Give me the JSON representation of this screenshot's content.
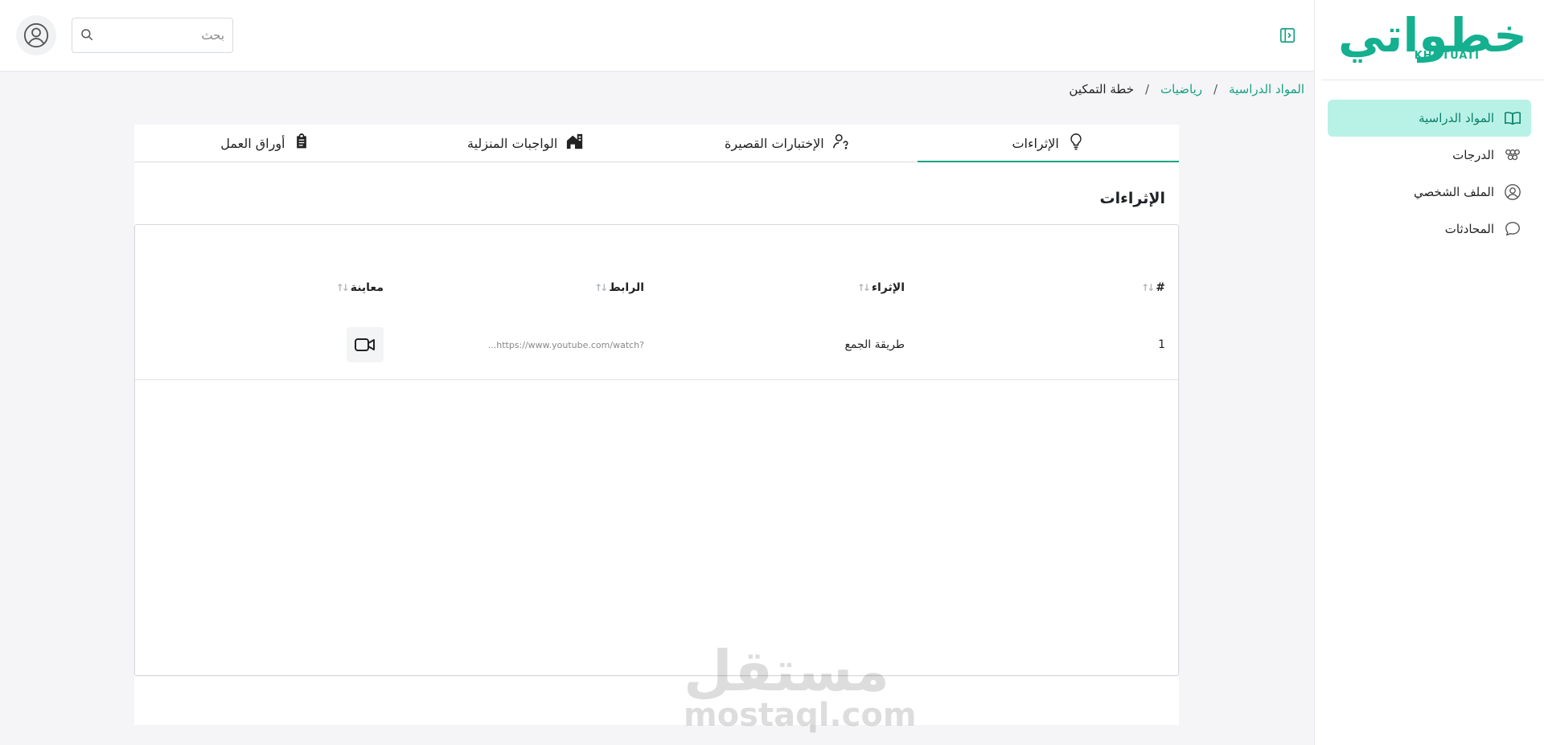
{
  "brand": {
    "logo_ar": "خطواتي",
    "logo_en": "KHUTUATI",
    "color": "#14b08f"
  },
  "sidebar": {
    "items": [
      {
        "label": "المواد الدراسية",
        "icon": "book-icon",
        "active": true
      },
      {
        "label": "الدرجات",
        "icon": "grades-icon",
        "active": false
      },
      {
        "label": "الملف الشخصي",
        "icon": "user-circle-icon",
        "active": false
      },
      {
        "label": "المحادثات",
        "icon": "chat-icon",
        "active": false
      }
    ]
  },
  "header": {
    "search_placeholder": "بحث",
    "search_icon": "search-icon",
    "avatar_icon": "user-avatar-icon",
    "collapse_icon": "sidebar-toggle-icon"
  },
  "breadcrumb": {
    "items": [
      "المواد الدراسية",
      "رياضيات",
      "خطة التمكين"
    ],
    "separator": "/"
  },
  "tabs": [
    {
      "label": "الإثراءات",
      "icon": "lightbulb-icon",
      "active": true
    },
    {
      "label": "الإختبارات القصيرة",
      "icon": "user-question-icon",
      "active": false
    },
    {
      "label": "الواجبات المنزلية",
      "icon": "house-icon",
      "active": false
    },
    {
      "label": "أوراق العمل",
      "icon": "clipboard-icon",
      "active": false
    }
  ],
  "section": {
    "title": "الإثراءات"
  },
  "table": {
    "columns": [
      "#",
      "الإثراء",
      "الرابط",
      "معاينة"
    ],
    "sort_glyph": "↑↓",
    "rows": [
      {
        "num": "1",
        "name": "طريقة الجمع",
        "link": "...https://www.youtube.com/watch?",
        "preview_icon": "video-camera-icon"
      }
    ]
  },
  "watermark": {
    "ar": "مستقل",
    "en": "mostaql.com"
  },
  "colors": {
    "accent": "#14a184",
    "active_bg": "#b8f2e6",
    "page_bg": "#f5f5f7"
  }
}
